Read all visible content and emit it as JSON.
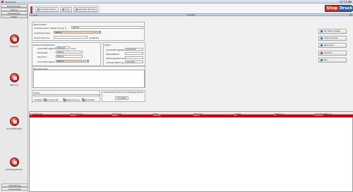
{
  "window": {
    "title": "Shopdruck"
  },
  "sidebar": {
    "headers": [
      "Einstellungen",
      "Online",
      "Dokumente",
      "Daten"
    ],
    "items": [
      {
        "label": "Inventar",
        "icon": "inventory-icon"
      },
      {
        "label": "Termine",
        "icon": "calendar-icon"
      },
      {
        "label": "Anschaffungen",
        "icon": "purchase-icon"
      },
      {
        "label": "Vertragspartner",
        "icon": "partner-icon"
      }
    ],
    "footer": [
      "Verwaltung",
      "Anschreiben"
    ]
  },
  "toolbar": {
    "buttons": [
      "Inventarisieren",
      "Liste",
      "aktuelle Termine"
    ],
    "logo_a": "Shop",
    "logo_b": "Druck"
  },
  "form": {
    "title": "Inventar",
    "stammdaten": {
      "title": "Stammdaten",
      "label_name": "Inventarname / Bezeichnung 1",
      "value_name": "Kabine",
      "label_group": "Inventargruppe",
      "value_group": "Kabine",
      "label_serial": "Seriennummer",
      "label_count": "Anzahl",
      "value_count": "10"
    },
    "anschaffung": {
      "title": "weitere Einzelheiten",
      "label_price": "Anschaffungspreis",
      "value_price": "2000,00",
      "unit_price": "Euro",
      "label_vendor": "Hersteller",
      "value_vendor": "Kabine",
      "label_location": "Standort",
      "value_location": "Kabine",
      "label_type": "Anschaffungsart",
      "value_type": "Kabine"
    },
    "daten": {
      "title": "Daten",
      "label_date": "Anschaffungsdatum",
      "value_date": "8.12.2011",
      "label_ablauf": "Ablaufdatum",
      "label_wartung": "Wartungsintervall",
      "label_next": "nächste Wartung",
      "value_next": "9.6.2012"
    },
    "bemerkungen": {
      "title": "Bemerkungen"
    },
    "suche": {
      "title": "Suche",
      "label_in": "Inhalten in:",
      "options": [
        "Inventar-Nr.",
        "Bezeichnung",
        "Hersteller"
      ]
    },
    "export": {
      "title": "Inventarliste für Excel Inventargegenstände",
      "button": "Vorlegen"
    }
  },
  "actions": [
    "Per Mail senden",
    "Liste Drucken",
    "Speichern",
    "Löschen",
    "Neu"
  ],
  "action_colors": [
    "#3a6db5",
    "#3a6db5",
    "#3a6db5",
    "#c0392b",
    "#2e8b3a"
  ],
  "table": {
    "columns": [
      "Inventar-Nr.",
      "Bezeichnung",
      "Hersteller",
      "Preis",
      "Standort",
      "Anzahl",
      "Wartung",
      "nächste Wartung"
    ],
    "rows": [
      [
        "1",
        "Kabine",
        "Kabine",
        "2000,00",
        "Kabine",
        "10",
        "6",
        "9.6.2012"
      ]
    ]
  }
}
